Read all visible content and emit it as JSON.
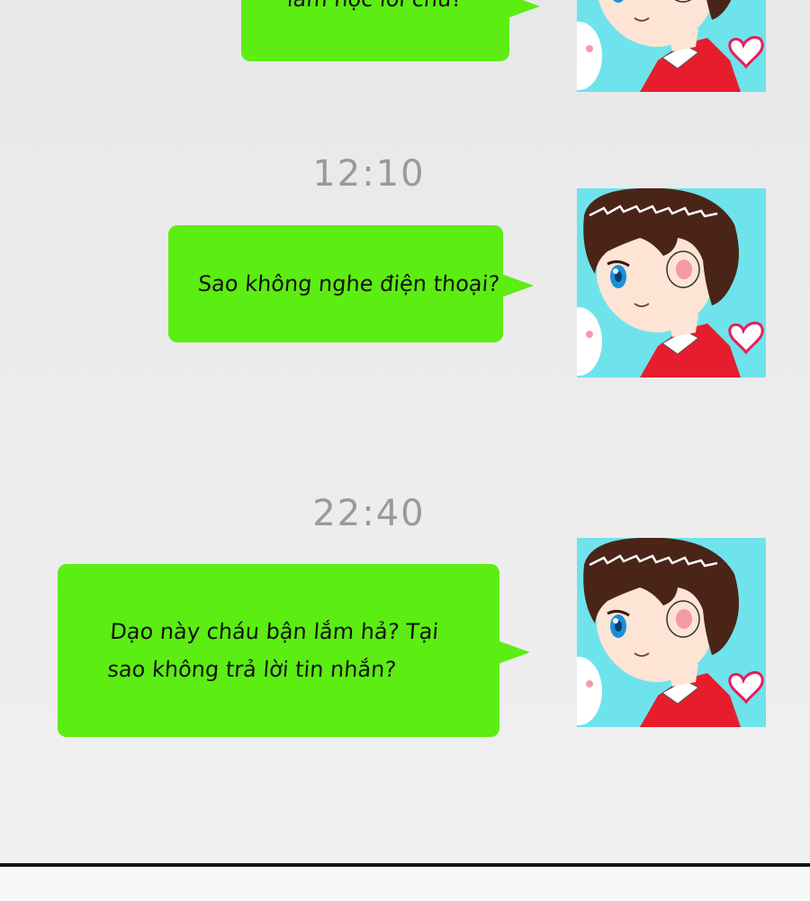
{
  "theme": {
    "bubble_color": "#5ced13",
    "timestamp_color": "#9a9a9a",
    "avatar_bg": "#6fe3ec"
  },
  "conversation": {
    "messages": [
      {
        "text": "lắm học lời chứ?",
        "avatar_icon": "boy-avatar-icon"
      },
      {
        "timestamp": "12:10",
        "text": "Sao không nghe điện thoại?",
        "avatar_icon": "boy-avatar-icon"
      },
      {
        "timestamp": "22:40",
        "text": "Dạo này cháu bận lắm hả? Tại\nsao không trả lời tin nhắn?",
        "avatar_icon": "boy-avatar-icon"
      }
    ]
  }
}
